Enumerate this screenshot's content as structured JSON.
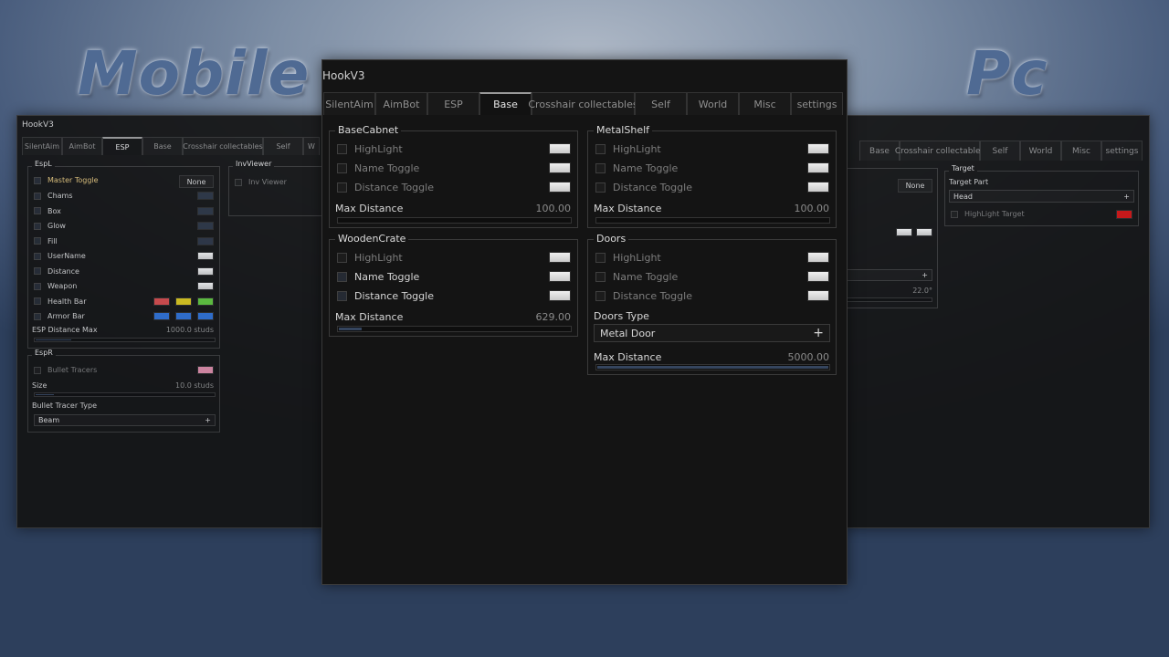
{
  "labels": {
    "mobile": "Mobile",
    "pc": "Pc"
  },
  "center": {
    "title": "HookV3",
    "tabs": [
      "SilentAim",
      "AimBot",
      "ESP",
      "Base",
      "Crosshair collectables",
      "Self",
      "World",
      "Misc",
      "settings"
    ],
    "active_tab": "Base",
    "base_cabnet": {
      "title": "BaseCabnet",
      "rows": [
        "HighLight",
        "Name Toggle",
        "Distance Toggle"
      ],
      "max_label": "Max Distance",
      "max_value": "100.00",
      "max_fraction": 0.0
    },
    "metal_shelf": {
      "title": "MetalShelf",
      "rows": [
        "HighLight",
        "Name Toggle",
        "Distance Toggle"
      ],
      "max_label": "Max Distance",
      "max_value": "100.00",
      "max_fraction": 0.0
    },
    "wooden_crate": {
      "title": "WoodenCrate",
      "rows": [
        "HighLight",
        "Name Toggle",
        "Distance Toggle"
      ],
      "max_label": "Max Distance",
      "max_value": "629.00",
      "max_fraction": 0.1
    },
    "doors": {
      "title": "Doors",
      "rows": [
        "HighLight",
        "Name Toggle",
        "Distance Toggle"
      ],
      "type_label": "Doors Type",
      "type_value": "Metal Door",
      "type_icon": "plus-icon",
      "max_label": "Max Distance",
      "max_value": "5000.00",
      "max_fraction": 1.0
    }
  },
  "mobile": {
    "title": "HookV3",
    "tabs": [
      "SilentAim",
      "AimBot",
      "ESP",
      "Base",
      "Crosshair collectables",
      "Self",
      "W"
    ],
    "active_tab": "ESP",
    "espl": {
      "title": "EspL",
      "master_label": "Master Toggle",
      "master_key": "None",
      "rows": [
        "Chams",
        "Box",
        "Glow",
        "Fill",
        "UserName",
        "Distance",
        "Weapon",
        "Health Bar",
        "Armor Bar"
      ],
      "health_colors": [
        "#d24a4a",
        "#d6c21c",
        "#5ec23c"
      ],
      "armor_colors": [
        "#2e6fd1",
        "#2e6fd1",
        "#2e6fd1"
      ],
      "dist_label": "ESP Distance Max",
      "dist_value": "1000.0 studs",
      "dist_fraction": 0.2
    },
    "esprr": {
      "title": "EspR",
      "tracers_label": "Bullet Tracers",
      "tracers_color": "#d98aa6",
      "size_label": "Size",
      "size_value": "10.0 studs",
      "size_fraction": 0.1,
      "type_label": "Bullet Tracer Type",
      "type_value": "Beam",
      "type_icon": "plus-icon"
    },
    "inv": {
      "title": "InvViewer",
      "row": "Inv Viewer"
    }
  },
  "pc": {
    "tabs": [
      "Base",
      "Crosshair collectables",
      "Self",
      "World",
      "Misc",
      "settings"
    ],
    "key": "None",
    "slider_value": "22.0°",
    "target": {
      "title": "Target",
      "part_label": "Target Part",
      "part_value": "Head",
      "part_icon": "plus-icon",
      "highlight_label": "HighLight Target",
      "highlight_color": "#d11414"
    }
  }
}
